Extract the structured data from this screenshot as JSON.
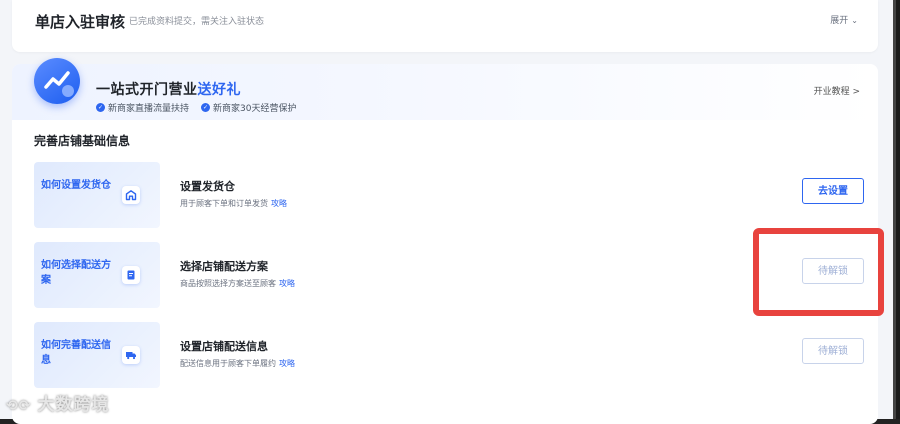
{
  "top_card": {
    "title": "单店入驻审核",
    "subtitle": "已完成资料提交，需关注入驻状态",
    "expand_label": "展开"
  },
  "promo": {
    "title_plain": "一站式开门营业",
    "title_highlight": "送好礼",
    "badges": [
      "新商家直播流量扶持",
      "新商家30天经营保护"
    ],
    "link_label": "开业教程 >"
  },
  "section": {
    "title": "完善店铺基础信息"
  },
  "tasks": [
    {
      "thumb_text": "如何设置发货仓",
      "icon": "warehouse-icon",
      "title": "设置发货仓",
      "desc": "用于顾客下单和订单发货",
      "link": "攻略",
      "button": "去设置",
      "button_state": "active"
    },
    {
      "thumb_text": "如何选择配送方案",
      "icon": "document-icon",
      "title": "选择店铺配送方案",
      "desc": "商品按照选择方案送至顾客",
      "link": "攻略",
      "button": "待解锁",
      "button_state": "locked"
    },
    {
      "thumb_text": "如何完善配送信息",
      "icon": "truck-icon",
      "title": "设置店铺配送信息",
      "desc": "配送信息用于顾客下单履约",
      "link": "攻略",
      "button": "待解锁",
      "button_state": "locked"
    }
  ],
  "watermark": "大数跨境",
  "colors": {
    "accent": "#2e66f0",
    "highlight": "#e8433e"
  }
}
